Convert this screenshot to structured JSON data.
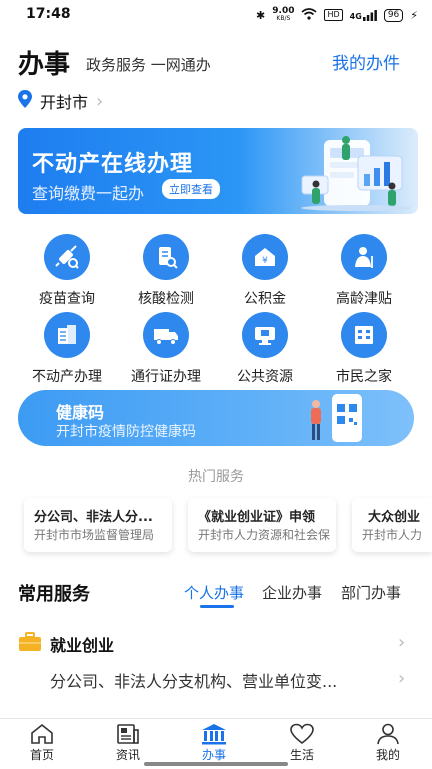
{
  "status_bar": {
    "time": "17:48",
    "speed_value": "9.00",
    "speed_unit": "KB/S",
    "signal_badge": "4G",
    "hd_badge": "HD",
    "battery": "96"
  },
  "header": {
    "title": "办事",
    "subtitle": "政务服务 一网通办",
    "my_tasks": "我的办件",
    "city": "开封市"
  },
  "banner": {
    "title": "不动产在线办理",
    "subtitle": "查询缴费一起办",
    "button": "立即查看"
  },
  "services_grid": [
    {
      "label": "疫苗查询",
      "icon": "syringe-icon"
    },
    {
      "label": "核酸检测",
      "icon": "test-tube-icon"
    },
    {
      "label": "公积金",
      "icon": "house-fund-icon"
    },
    {
      "label": "高龄津贴",
      "icon": "elderly-icon"
    },
    {
      "label": "不动产办理",
      "icon": "building-doc-icon"
    },
    {
      "label": "通行证办理",
      "icon": "truck-icon"
    },
    {
      "label": "公共资源",
      "icon": "computer-icon"
    },
    {
      "label": "市民之家",
      "icon": "city-hall-icon"
    }
  ],
  "health_code": {
    "title": "健康码",
    "subtitle": "开封市疫情防控健康码"
  },
  "hot_services": {
    "title": "热门服务",
    "cards": [
      {
        "title": "分公司、非法人分...",
        "dept": "开封市市场监督管理局"
      },
      {
        "title": "《就业创业证》申领",
        "dept": "开封市人力资源和社会保"
      },
      {
        "title": "大众创业",
        "dept": "开封市人力"
      }
    ]
  },
  "common_services": {
    "title": "常用服务",
    "tabs": [
      "个人办事",
      "企业办事",
      "部门办事"
    ],
    "active_tab": "个人办事",
    "category": "就业创业",
    "item": "分公司、非法人分支机构、营业单位变..."
  },
  "bottom_nav": [
    {
      "label": "首页",
      "icon": "home-icon"
    },
    {
      "label": "资讯",
      "icon": "news-icon"
    },
    {
      "label": "办事",
      "icon": "bank-icon"
    },
    {
      "label": "生活",
      "icon": "heart-icon"
    },
    {
      "label": "我的",
      "icon": "user-icon"
    }
  ],
  "colors": {
    "accent": "#1a73e8",
    "icon_blue": "#2e88ee",
    "category_icon": "#f5b324"
  }
}
